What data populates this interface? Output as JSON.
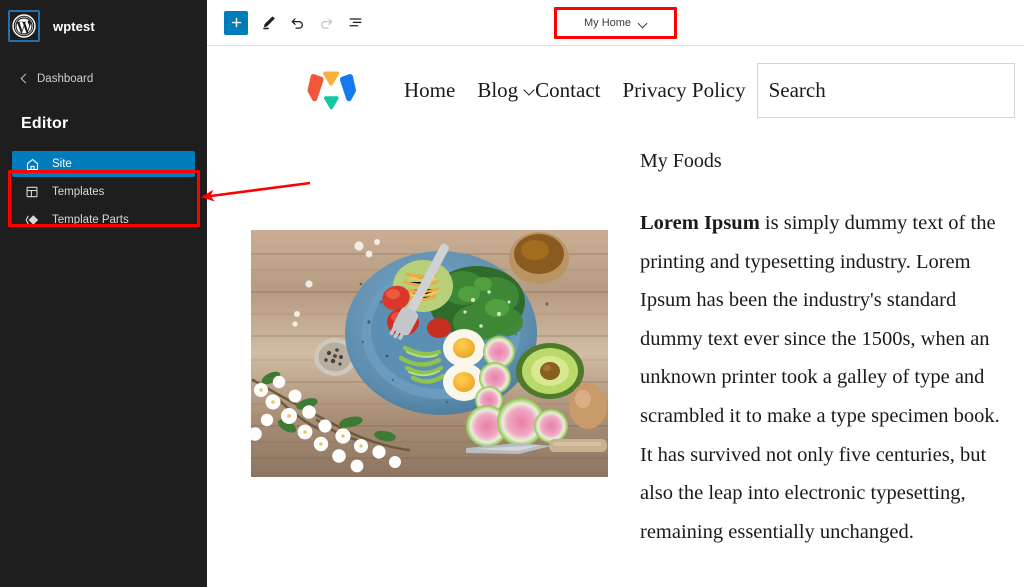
{
  "sidebar": {
    "site_title": "wptest",
    "logo_icon": "wordpress-logo-icon",
    "back_link": {
      "label": "Dashboard",
      "icon": "chevron-left-icon"
    },
    "heading": "Editor",
    "items": [
      {
        "label": "Site",
        "icon": "home-icon",
        "active": true
      },
      {
        "label": "Templates",
        "icon": "layout-icon",
        "active": false
      },
      {
        "label": "Template Parts",
        "icon": "template-parts-icon",
        "active": false
      }
    ],
    "annotation": {
      "highlight_color": "#ff0000",
      "arrow_icon": "left-arrow-annotation-icon"
    }
  },
  "toolbar": {
    "buttons": [
      {
        "name": "add-block",
        "icon": "plus-icon",
        "label": "Add block",
        "primary": true
      },
      {
        "name": "edit-tool",
        "icon": "pencil-icon",
        "label": "Edit",
        "primary": false
      },
      {
        "name": "undo",
        "icon": "undo-arrow-icon",
        "label": "Undo",
        "primary": false,
        "disabled": false
      },
      {
        "name": "redo",
        "icon": "redo-arrow-icon",
        "label": "Redo",
        "primary": false,
        "disabled": true
      },
      {
        "name": "list-view",
        "icon": "list-view-icon",
        "label": "List View",
        "primary": false
      }
    ],
    "document_title": "My Home",
    "document_title_icon": "chevron-down-icon",
    "document_title_highlight": "#ff0000"
  },
  "site": {
    "logo": {
      "icon": "w-mark-logo-icon",
      "colors": {
        "red": "#f4563a",
        "orange": "#f9b03a",
        "blue": "#1579f2",
        "teal": "#0fc9a0"
      }
    },
    "nav": [
      {
        "label": "Home",
        "has_submenu": false
      },
      {
        "label": "Blog",
        "has_submenu": true,
        "caret_icon": "chevron-down-icon"
      },
      {
        "label": "Contact",
        "has_submenu": false
      },
      {
        "label": "Privacy Policy",
        "has_submenu": false
      }
    ],
    "search": {
      "placeholder": "Search",
      "value": ""
    },
    "content": {
      "image_alt": "Overhead photo of a blue plate with salad, boiled eggs, tomatoes, cucumber and radish slices on a rustic wooden table, with an avocado half, a brown egg, a knife and white blossoms beside it",
      "heading": "My Foods",
      "lead": "Lorem Ipsum",
      "body": " is simply dummy text of the printing and typesetting industry. Lorem Ipsum has been the industry's standard dummy text ever since the 1500s, when an unknown printer took a galley of type and scrambled it to make a type specimen book. It has survived not only five centuries, but also the leap into electronic typesetting, remaining essentially unchanged."
    }
  }
}
